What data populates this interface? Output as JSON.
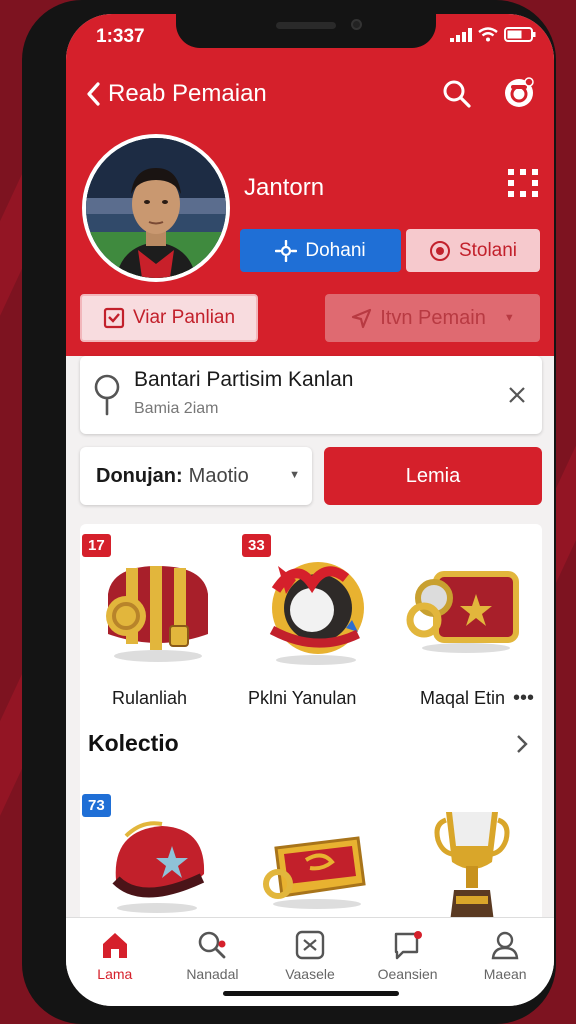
{
  "status": {
    "time": "1:337"
  },
  "header": {
    "title": "Reab Pemaian"
  },
  "profile": {
    "name": "Jantorn",
    "primary_button": "Dohani",
    "secondary_button": "Stolani",
    "view_button": "Viar Panlian",
    "dropdown_button": "Itvn Pemain"
  },
  "search_card": {
    "title": "Bantari Partisim Kanlan",
    "subtitle": "Bamia 2iam"
  },
  "filter": {
    "label": "Donujan:",
    "value": "Maotio",
    "action_button": "Lemia"
  },
  "items": [
    {
      "badge": "17",
      "label": "Rulanliah"
    },
    {
      "badge": "33",
      "label": "Pklni Yanulan"
    },
    {
      "badge": "",
      "label": "Maqal Etin"
    }
  ],
  "collection": {
    "title": "Kolectio",
    "items": [
      {
        "badge": "73"
      },
      {
        "badge": ""
      },
      {
        "badge": ""
      }
    ]
  },
  "tabs": [
    {
      "label": "Lama",
      "icon": "home-icon"
    },
    {
      "label": "Nanadal",
      "icon": "search-icon"
    },
    {
      "label": "Vaasele",
      "icon": "scan-icon"
    },
    {
      "label": "Oeansien",
      "icon": "chat-icon"
    },
    {
      "label": "Maean",
      "icon": "profile-icon"
    }
  ],
  "colors": {
    "brand_red": "#d5202b",
    "accent_blue": "#1f6fd6",
    "badge_blue": "#1f6fd6"
  }
}
